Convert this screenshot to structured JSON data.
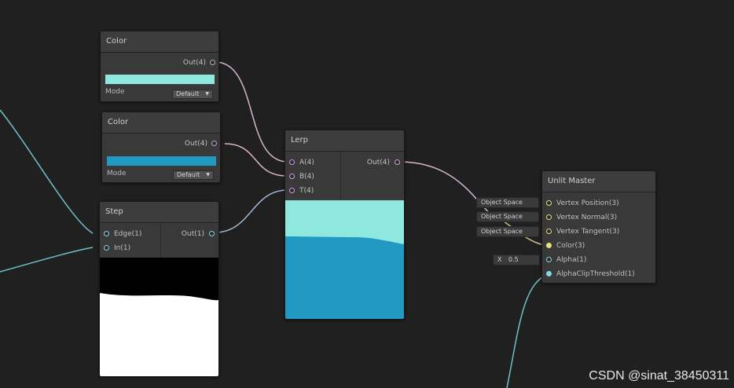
{
  "colors": {
    "cyan": "#8ee8de",
    "blue": "#2199c3",
    "wire_pink": "#d8b4cf",
    "wire_teal": "#6fbfc8",
    "wire_yellow": "#c8c07a"
  },
  "nodes": {
    "color1": {
      "title": "Color",
      "out": "Out(4)",
      "mode_label": "Mode",
      "mode_value": "Default"
    },
    "color2": {
      "title": "Color",
      "out": "Out(4)",
      "mode_label": "Mode",
      "mode_value": "Default"
    },
    "step": {
      "title": "Step",
      "in1": "Edge(1)",
      "in2": "In(1)",
      "out": "Out(1)"
    },
    "lerp": {
      "title": "Lerp",
      "a": "A(4)",
      "b": "B(4)",
      "t": "T(4)",
      "out": "Out(4)"
    },
    "master": {
      "title": "Unlit Master",
      "ports": [
        "Vertex Position(3)",
        "Vertex Normal(3)",
        "Vertex Tangent(3)",
        "Color(3)",
        "Alpha(1)",
        "AlphaClipThreshold(1)"
      ],
      "space_pills": [
        "Object Space",
        "Object Space",
        "Object Space"
      ],
      "alpha_axis": "X",
      "alpha_value": "0.5"
    }
  },
  "watermark": "CSDN @sinat_38450311"
}
